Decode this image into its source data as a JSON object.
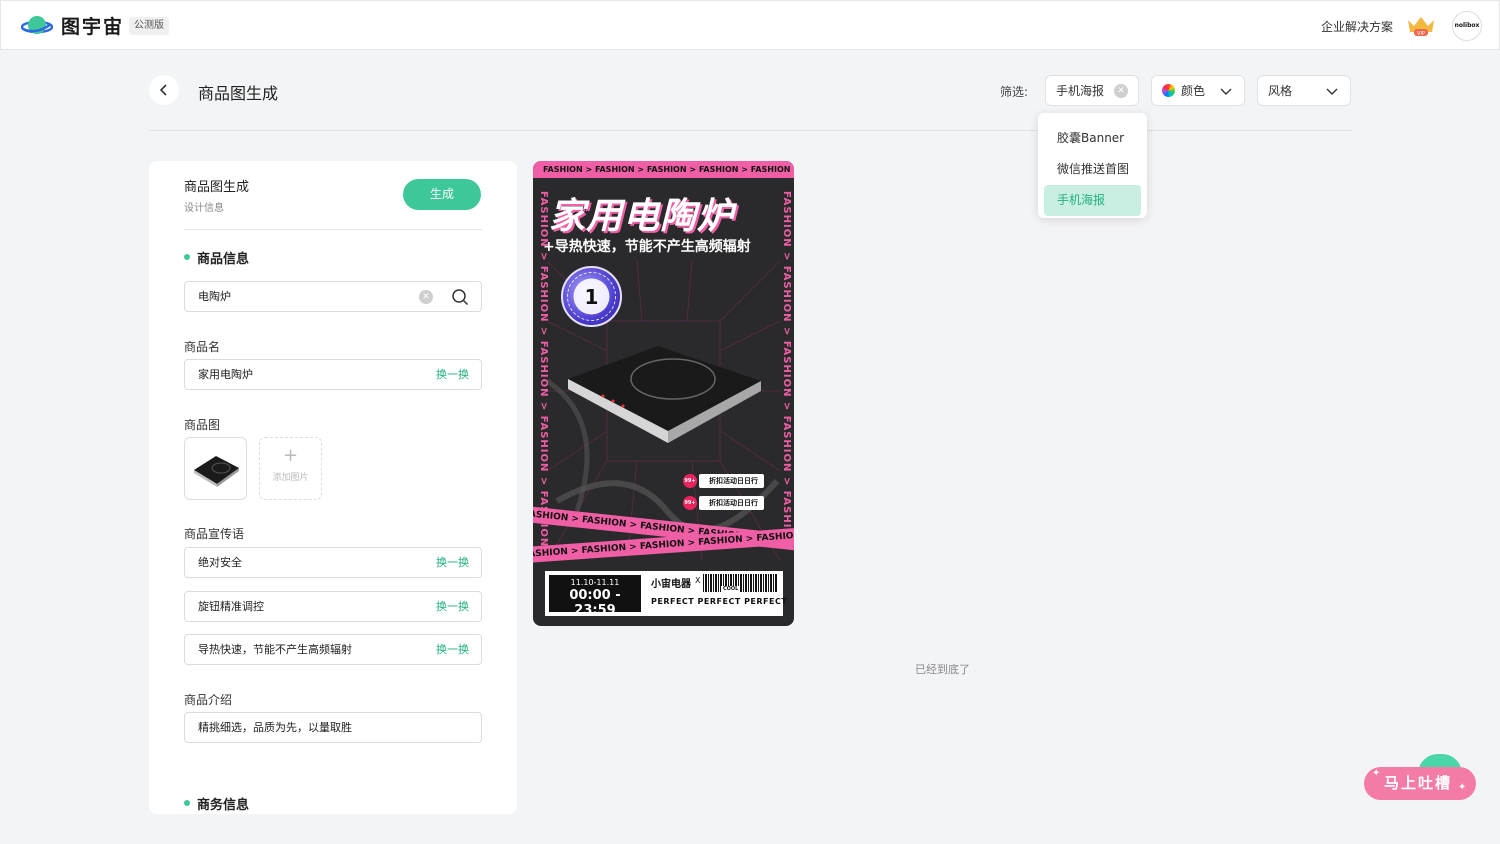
{
  "app": {
    "name": "图宇宙",
    "beta_tag": "公测版",
    "enterprise_link": "企业解决方案",
    "vip_label": "VIP",
    "avatar_text": "nolibox"
  },
  "header": {
    "page_title": "商品图生成",
    "filter_label": "筛选:",
    "filter_type_value": "手机海报",
    "filter_color_label": "颜色",
    "filter_style_label": "风格"
  },
  "dropdown": {
    "items": [
      "胶囊Banner",
      "微信推送首图",
      "手机海报"
    ],
    "selected": "手机海报"
  },
  "panel": {
    "title": "商品图生成",
    "subtitle": "设计信息",
    "generate_label": "生成",
    "product_info_heading": "商品信息",
    "search_value": "电陶炉",
    "product_name_label": "商品名",
    "product_name_value": "家用电陶炉",
    "swap_label": "换一换",
    "product_image_label": "商品图",
    "add_image_label": "添加图片",
    "slogan_label": "商品宣传语",
    "slogans": [
      "绝对安全",
      "旋钮精准调控",
      "导热快速，节能不产生高频辐射"
    ],
    "intro_label": "商品介绍",
    "intro_value": "精挑细选，品质为先，以量取胜",
    "business_heading": "商务信息"
  },
  "poster": {
    "top_band": "FASHION > FASHION > FASHION > FASHION > FASHION > FASHION >",
    "side_text": "FASHION > FASHION > FASHION > FASHION > FASHION",
    "title": "家用电陶炉",
    "subtitle": "+导热快速，节能不产生高频辐射",
    "badge_text": "FASHION FASHION",
    "badge_number": "1",
    "tag_badge": "99+",
    "tag_text": "折扣活动日日行",
    "tape_1": "FASHION > FASHION > FASHION > FASHION > FASHION >",
    "tape_2": "FASHION > FASHION > FASHION > FASHION > FASHION >",
    "date_range": "11.10-11.11",
    "time_range": "00:00 - 23:59",
    "brand": "小宙电器",
    "brand_x": "X",
    "cool_tag": "COOL",
    "perfect_text": "PERFECT PERFECT PERFECT"
  },
  "end_text": "已经到底了",
  "feedback_label": "马上吐槽",
  "colors": {
    "accent": "#3ec89a",
    "accent_text": "#22b07d",
    "poster_pink": "#f05fa5",
    "poster_bg": "#2a2a2c"
  }
}
